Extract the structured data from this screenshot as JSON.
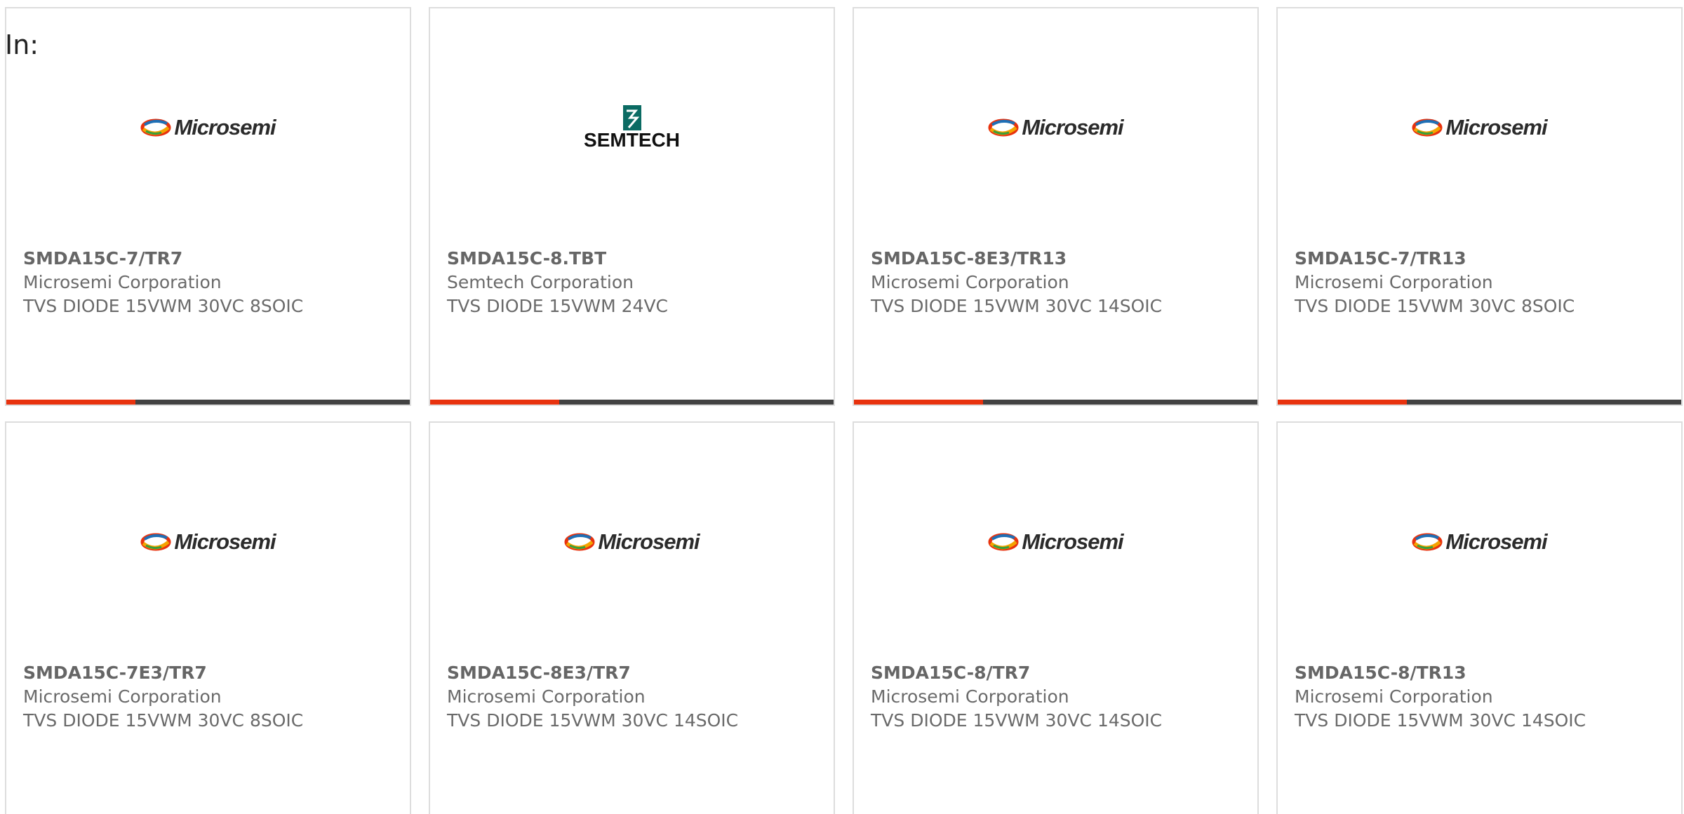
{
  "filter_label": "In:",
  "colors": {
    "progress_accent": "#e8320e",
    "progress_track": "#424242",
    "card_border": "#dddddd",
    "text_muted": "#666666"
  },
  "logos": {
    "microsemi": {
      "name": "microsemi-logo",
      "text": "Microsemi"
    },
    "semtech": {
      "name": "semtech-logo",
      "text": "SEMTECH"
    }
  },
  "products": [
    {
      "part": "SMDA15C-7/TR7",
      "manufacturer": "Microsemi Corporation",
      "description": "TVS DIODE 15VWM 30VC 8SOIC",
      "logo": "microsemi",
      "progress": 0.32
    },
    {
      "part": "SMDA15C-8.TBT",
      "manufacturer": "Semtech Corporation",
      "description": "TVS DIODE 15VWM 24VC",
      "logo": "semtech",
      "progress": 0.32
    },
    {
      "part": "SMDA15C-8E3/TR13",
      "manufacturer": "Microsemi Corporation",
      "description": "TVS DIODE 15VWM 30VC 14SOIC",
      "logo": "microsemi",
      "progress": 0.32
    },
    {
      "part": "SMDA15C-7/TR13",
      "manufacturer": "Microsemi Corporation",
      "description": "TVS DIODE 15VWM 30VC 8SOIC",
      "logo": "microsemi",
      "progress": 0.32
    },
    {
      "part": "SMDA15C-7E3/TR7",
      "manufacturer": "Microsemi Corporation",
      "description": "TVS DIODE 15VWM 30VC 8SOIC",
      "logo": "microsemi"
    },
    {
      "part": "SMDA15C-8E3/TR7",
      "manufacturer": "Microsemi Corporation",
      "description": "TVS DIODE 15VWM 30VC 14SOIC",
      "logo": "microsemi"
    },
    {
      "part": "SMDA15C-8/TR7",
      "manufacturer": "Microsemi Corporation",
      "description": "TVS DIODE 15VWM 30VC 14SOIC",
      "logo": "microsemi"
    },
    {
      "part": "SMDA15C-8/TR13",
      "manufacturer": "Microsemi Corporation",
      "description": "TVS DIODE 15VWM 30VC 14SOIC",
      "logo": "microsemi"
    }
  ]
}
